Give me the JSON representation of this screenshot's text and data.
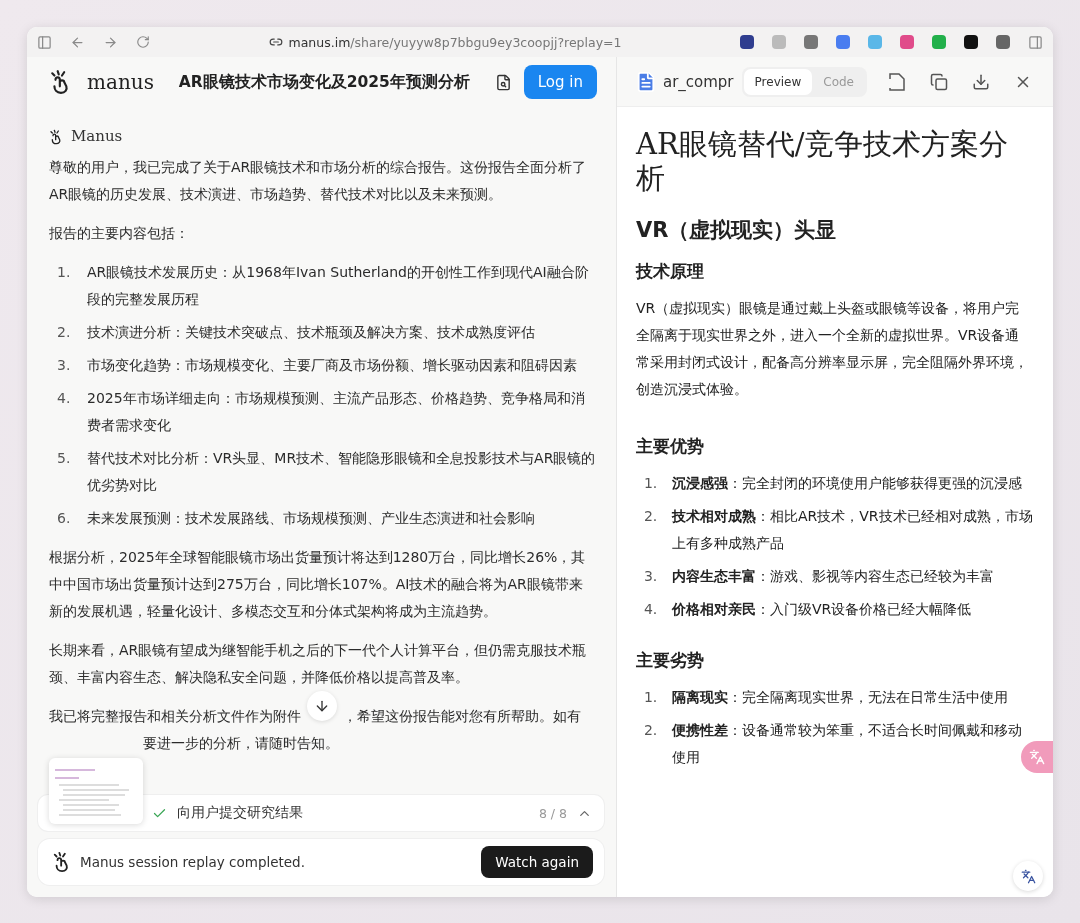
{
  "browser": {
    "url_host": "manus.im",
    "url_path": "/share/yuyyw8p7bbgu9ey3coopjj?replay=1"
  },
  "header": {
    "brand": "manus",
    "title": "AR眼镜技术市场变化及2025年预测分析",
    "login": "Log in"
  },
  "chat": {
    "sender": "Manus",
    "intro": "尊敬的用户，我已完成了关于AR眼镜技术和市场分析的综合报告。这份报告全面分析了AR眼镜的历史发展、技术演进、市场趋势、替代技术对比以及未来预测。",
    "list_heading": "报告的主要内容包括：",
    "items": [
      {
        "number": "1.",
        "text": "AR眼镜技术发展历史：从1968年Ivan Sutherland的开创性工作到现代AI融合阶段的完整发展历程"
      },
      {
        "number": "2.",
        "text": "技术演进分析：关键技术突破点、技术瓶颈及解决方案、技术成熟度评估"
      },
      {
        "number": "3.",
        "text": "市场变化趋势：市场规模变化、主要厂商及市场份额、增长驱动因素和阻碍因素"
      },
      {
        "number": "4.",
        "text": "2025年市场详细走向：市场规模预测、主流产品形态、价格趋势、竞争格局和消费者需求变化"
      },
      {
        "number": "5.",
        "text": "替代技术对比分析：VR头显、MR技术、智能隐形眼镜和全息投影技术与AR眼镜的优劣势对比"
      },
      {
        "number": "6.",
        "text": "未来发展预测：技术发展路线、市场规模预测、产业生态演进和社会影响"
      }
    ],
    "paragraphs": [
      "根据分析，2025年全球智能眼镜市场出货量预计将达到1280万台，同比增长26%，其中中国市场出货量预计达到275万台，同比增长107%。AI技术的融合将为AR眼镜带来新的发展机遇，轻量化设计、多模态交互和分体式架构将成为主流趋势。",
      "长期来看，AR眼镜有望成为继智能手机之后的下一代个人计算平台，但仍需克服技术瓶颈、丰富内容生态、解决隐私安全问题，并降低价格以提高普及率。"
    ],
    "covered_paragraph": {
      "line_1_start": "我已将完整报告和相关分析文件作为附件",
      "line_1_end": "，希望这份报告能对您有所帮助。如有",
      "line_2": "要进一步的分析，请随时告知。"
    }
  },
  "step": {
    "label": "向用户提交研究结果",
    "done": true,
    "counter": "8 / 8"
  },
  "replay": {
    "message": "Manus session replay completed.",
    "button": "Watch again"
  },
  "file_panel": {
    "filename": "ar_compr",
    "tabs": [
      {
        "label": "Preview",
        "selected": true
      },
      {
        "label": "Code",
        "selected": false
      }
    ]
  },
  "document": {
    "title": "AR眼镜替代/竞争技术方案分析",
    "section": "VR（虚拟现实）头显",
    "blocks": [
      {
        "kind": "heading",
        "text": "技术原理"
      },
      {
        "kind": "paragraph",
        "text": "VR（虚拟现实）眼镜是通过戴上头盔或眼镜等设备，将用户完全隔离于现实世界之外，进入一个全新的虚拟世界。VR设备通常采用封闭式设计，配备高分辨率显示屏，完全阻隔外界环境，创造沉浸式体验。"
      },
      {
        "kind": "heading",
        "text": "主要优势"
      },
      {
        "kind": "list",
        "items": [
          {
            "number": "1.",
            "text": "**沉浸感强**：完全封闭的环境使用户能够获得更强的沉浸感"
          },
          {
            "number": "2.",
            "text": "**技术相对成熟**：相比AR技术，VR技术已经相对成熟，市场上有多种成熟产品"
          },
          {
            "number": "3.",
            "text": "**内容生态丰富**：游戏、影视等内容生态已经较为丰富"
          },
          {
            "number": "4.",
            "text": "**价格相对亲民**：入门级VR设备价格已经大幅降低"
          }
        ]
      },
      {
        "kind": "heading",
        "text": "主要劣势"
      },
      {
        "kind": "list",
        "items": [
          {
            "number": "1.",
            "text": "**隔离现实**：完全隔离现实世界，无法在日常生活中使用"
          },
          {
            "number": "2.",
            "text": "**便携性差**：设备通常较为笨重，不适合长时间佩戴和移动使用"
          }
        ]
      }
    ]
  }
}
